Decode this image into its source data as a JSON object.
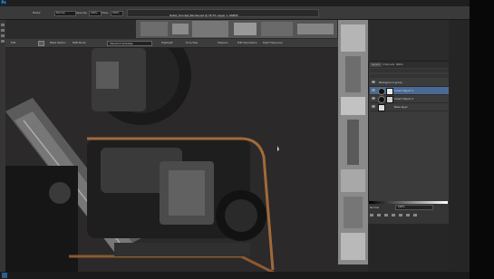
{
  "app": {
    "logo": "Ps"
  },
  "menubar": {
    "items": [
      "Ps"
    ]
  },
  "options": {
    "fields": [
      "Normal",
      "100%",
      "100%"
    ],
    "labels": [
      "Opacity:",
      "Flow:"
    ]
  },
  "document": {
    "title": "Robot_Concept_Render.psd @ 33.3% (Layer 1, RGB/8)"
  },
  "toolbar2": {
    "items": [
      "Edit",
      "Mask Option",
      "RGB Mode",
      "Standard Antialias",
      "Highlight",
      "Tone Size",
      "Sharpen",
      "Edit Operations",
      "High Frequency"
    ]
  },
  "layers": {
    "tabs": [
      "Layers",
      "Channels",
      "Paths"
    ],
    "rows": [
      {
        "name": "Background group"
      },
      {
        "name": "Smart Object 1"
      },
      {
        "name": "Smart Object 2"
      },
      {
        "name": "Base layer"
      }
    ],
    "blend_mode": "Normal",
    "opacity": "100%",
    "accent": "#3d5a80"
  },
  "colors": {
    "canvas_bg": "#2b2929",
    "panel_bg": "#3b3b3b",
    "selected_row": "#4a6a95"
  }
}
